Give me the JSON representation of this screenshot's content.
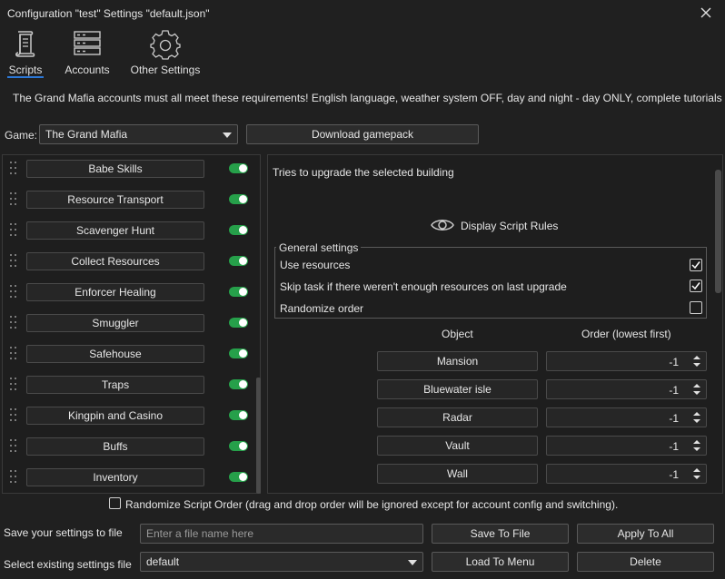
{
  "window": {
    "title": "Configuration \"test\" Settings \"default.json\""
  },
  "tabs": [
    {
      "label": "Scripts",
      "icon": "scroll-icon",
      "active": true
    },
    {
      "label": "Accounts",
      "icon": "server-icon",
      "active": false
    },
    {
      "label": "Other Settings",
      "icon": "gear-icon",
      "active": false
    }
  ],
  "notice": "The Grand Mafia accounts must all meet these requirements! English language, weather system OFF, day and night - day ONLY, complete tutorials",
  "game": {
    "label": "Game:",
    "selected": "The Grand Mafia",
    "download_label": "Download gamepack"
  },
  "scripts": [
    {
      "name": "Babe Skills",
      "enabled": true
    },
    {
      "name": "Resource Transport",
      "enabled": true
    },
    {
      "name": "Scavenger Hunt",
      "enabled": true
    },
    {
      "name": "Collect Resources",
      "enabled": true
    },
    {
      "name": "Enforcer Healing",
      "enabled": true
    },
    {
      "name": "Smuggler",
      "enabled": true
    },
    {
      "name": "Safehouse",
      "enabled": true
    },
    {
      "name": "Traps",
      "enabled": true
    },
    {
      "name": "Kingpin and Casino",
      "enabled": true
    },
    {
      "name": "Buffs",
      "enabled": true
    },
    {
      "name": "Inventory",
      "enabled": true
    }
  ],
  "detail": {
    "description": "Tries to upgrade the selected building",
    "rules_label": "Display Script Rules",
    "general_title": "General settings",
    "options": [
      {
        "label": "Use resources",
        "checked": true
      },
      {
        "label": "Skip task if there weren't enough resources on last upgrade",
        "checked": true
      },
      {
        "label": "Randomize order",
        "checked": false
      }
    ],
    "col_object": "Object",
    "col_order": "Order (lowest first)",
    "objects": [
      {
        "name": "Mansion",
        "order": "-1"
      },
      {
        "name": "Bluewater isle",
        "order": "-1"
      },
      {
        "name": "Radar",
        "order": "-1"
      },
      {
        "name": "Vault",
        "order": "-1"
      },
      {
        "name": "Wall",
        "order": "-1"
      }
    ]
  },
  "randomize": {
    "label": "Randomize Script Order (drag and drop order will be ignored except for account config and switching).",
    "checked": false
  },
  "save": {
    "label": "Save your settings to file",
    "placeholder": "Enter a file name here",
    "save_btn": "Save To File",
    "apply_btn": "Apply To All"
  },
  "load": {
    "label": "Select existing settings file",
    "selected": "default",
    "load_btn": "Load To Menu",
    "delete_btn": "Delete"
  },
  "colors": {
    "toggle_on": "#26a04a",
    "accent": "#2b78d8"
  }
}
